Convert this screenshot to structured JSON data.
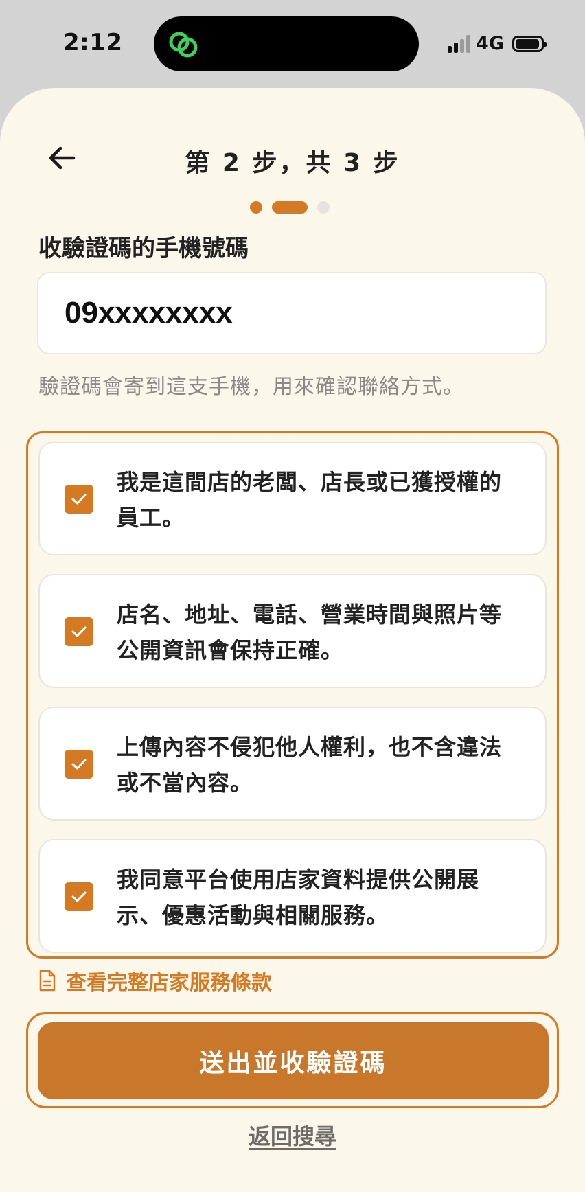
{
  "status_bar": {
    "time": "2:12",
    "network": "4G",
    "icons": [
      "signal-icon",
      "battery-icon",
      "link-app-icon"
    ]
  },
  "header": {
    "back_icon": "arrow-left-icon",
    "step_title": "第 2 步，共 3 步"
  },
  "progress": {
    "current_step": 2,
    "total_steps": 3,
    "accent_color": "#d47a24",
    "inactive_color": "#e6e3df"
  },
  "phone": {
    "label": "收驗證碼的手機號碼",
    "value": "09xxxxxxxx",
    "hint": "驗證碼會寄到這支手機，用來確認聯絡方式。"
  },
  "agreements": [
    {
      "text": "我是這間店的老闆、店長或已獲授權的員工。",
      "checked": true
    },
    {
      "text": "店名、地址、電話、營業時間與照片等公開資訊會保持正確。",
      "checked": true
    },
    {
      "text": "上傳內容不侵犯他人權利，也不含違法或不當內容。",
      "checked": true
    },
    {
      "text": "我同意平台使用店家資料提供公開展示、優惠活動與相關服務。",
      "checked": true
    }
  ],
  "terms_link": {
    "label": "查看完整店家服務條款",
    "icon": "document-icon"
  },
  "submit_button": {
    "label": "送出並收驗證碼",
    "color": "#c8772b"
  },
  "back_to_search": {
    "label": "返回搜尋"
  },
  "colors": {
    "background": "#fbf7ea",
    "accent": "#d47a24"
  }
}
